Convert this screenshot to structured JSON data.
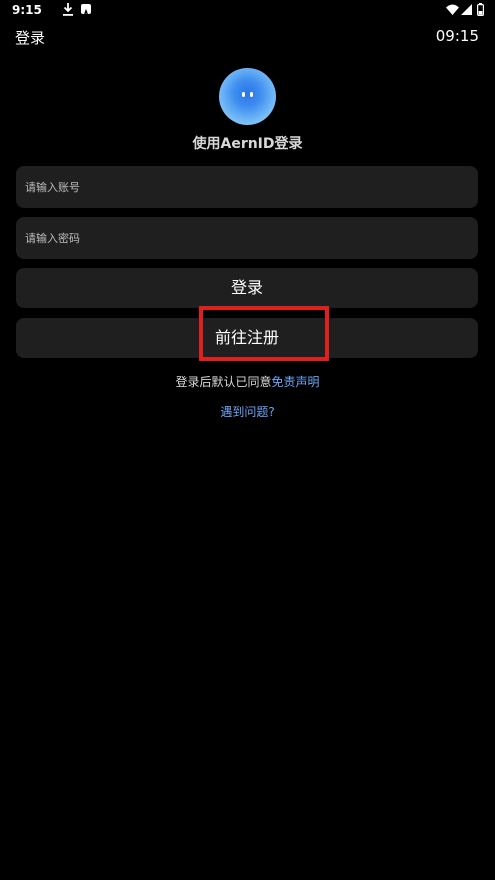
{
  "status_bar": {
    "time": "9:15",
    "icons": [
      "download-icon",
      "a-icon",
      "wifi-icon",
      "signal-icon",
      "battery-icon"
    ]
  },
  "app_bar": {
    "title": "登录",
    "clock": "09:15"
  },
  "logo": {
    "icon": "aern-logo-icon"
  },
  "heading": "使用AernID登录",
  "fields": {
    "account_placeholder": "请输入账号",
    "account_value": "",
    "password_placeholder": "请输入密码",
    "password_value": ""
  },
  "buttons": {
    "login_label": "登录",
    "register_label": "前往注册"
  },
  "disclaimer": {
    "prefix": "登录后默认已同意",
    "link": "免责声明"
  },
  "help_link": "遇到问题?",
  "colors": {
    "background": "#000000",
    "surface": "#1f1f1f",
    "link": "#6aa6f7",
    "highlight": "#e0201f"
  }
}
